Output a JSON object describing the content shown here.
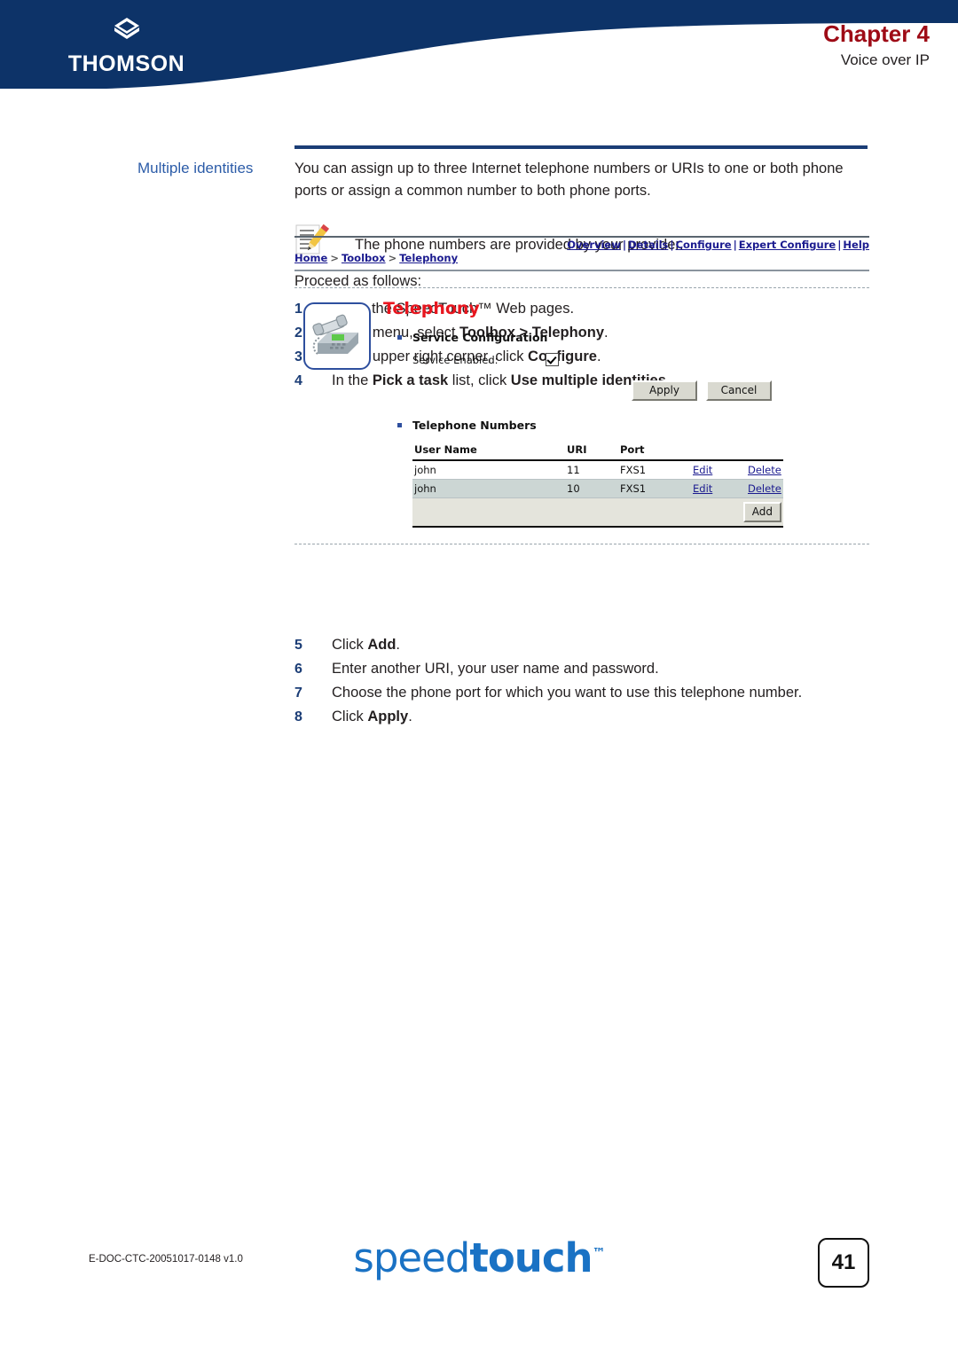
{
  "header": {
    "brand": "THOMSON",
    "brand_logo_icon": "thomson-diamond-logo",
    "chapter_title": "Chapter 4",
    "chapter_subtitle": "Voice over IP",
    "chapter_color": "#9e0b16",
    "band_color": "#0d3368"
  },
  "topic": {
    "margin_label": "Multiple identities",
    "intro": "You can assign up to three Internet telephone numbers or URIs to one or both phone ports or assign a common number to both phone ports.",
    "note_icon": "note-pencil-icon",
    "note_text": "The phone numbers are provided by your provider.",
    "proceed_label": "Proceed as follows:"
  },
  "steps_upper": [
    {
      "num": "1",
      "text_pre": "Go to the SpeedTouch™ Web pages.",
      "bold": "",
      "text_post": ""
    },
    {
      "num": "2",
      "text_pre": "In the menu, select ",
      "bold": "Toolbox > Telephony",
      "text_post": "."
    },
    {
      "num": "3",
      "text_pre": "In the upper right corner, click ",
      "bold": "Configure",
      "text_post": "."
    },
    {
      "num": "4",
      "text_pre": "In the ",
      "bold": "Pick a task",
      "text_post": " list, click ",
      "bold2": "Use multiple identities",
      "text_post2": "."
    }
  ],
  "steps_lower": [
    {
      "num": "5",
      "text_pre": "Click ",
      "bold": "Add",
      "text_post": "."
    },
    {
      "num": "6",
      "text_pre": "Enter another URI, your user name and password.",
      "bold": "",
      "text_post": ""
    },
    {
      "num": "7",
      "text_pre": "Choose the phone port for which you want to use this telephone number.",
      "bold": "",
      "text_post": ""
    },
    {
      "num": "8",
      "text_pre": "Click ",
      "bold": "Apply",
      "text_post": "."
    }
  ],
  "webui": {
    "nav_links": [
      "Overview",
      "Details",
      "Configure",
      "Expert Configure",
      "Help"
    ],
    "nav_separator": "|",
    "breadcrumb": [
      "Home",
      "Toolbox",
      "Telephony"
    ],
    "breadcrumb_separator": ">",
    "panel_icon": "desk-phone-icon",
    "panel_title": "Telephony",
    "panel_title_color": "#e8161f",
    "section_service": {
      "label": "Service Configuration",
      "field_label": "Service Enabled:",
      "checked": true
    },
    "buttons": {
      "apply": "Apply",
      "cancel": "Cancel",
      "add": "Add"
    },
    "section_numbers": {
      "label": "Telephone Numbers",
      "columns": [
        "User Name",
        "URI",
        "Port",
        "",
        ""
      ],
      "rows": [
        {
          "user_name": "john",
          "uri": "11",
          "port": "FXS1",
          "edit": "Edit",
          "delete": "Delete"
        },
        {
          "user_name": "john",
          "uri": "10",
          "port": "FXS1",
          "edit": "Edit",
          "delete": "Delete"
        }
      ]
    }
  },
  "footer": {
    "doc_id": "E-DOC-CTC-20051017-0148 v1.0",
    "logo_part1": "speed",
    "logo_part2": "touch",
    "logo_tm": "™",
    "logo_color": "#1a72c4",
    "page_number": "41"
  }
}
